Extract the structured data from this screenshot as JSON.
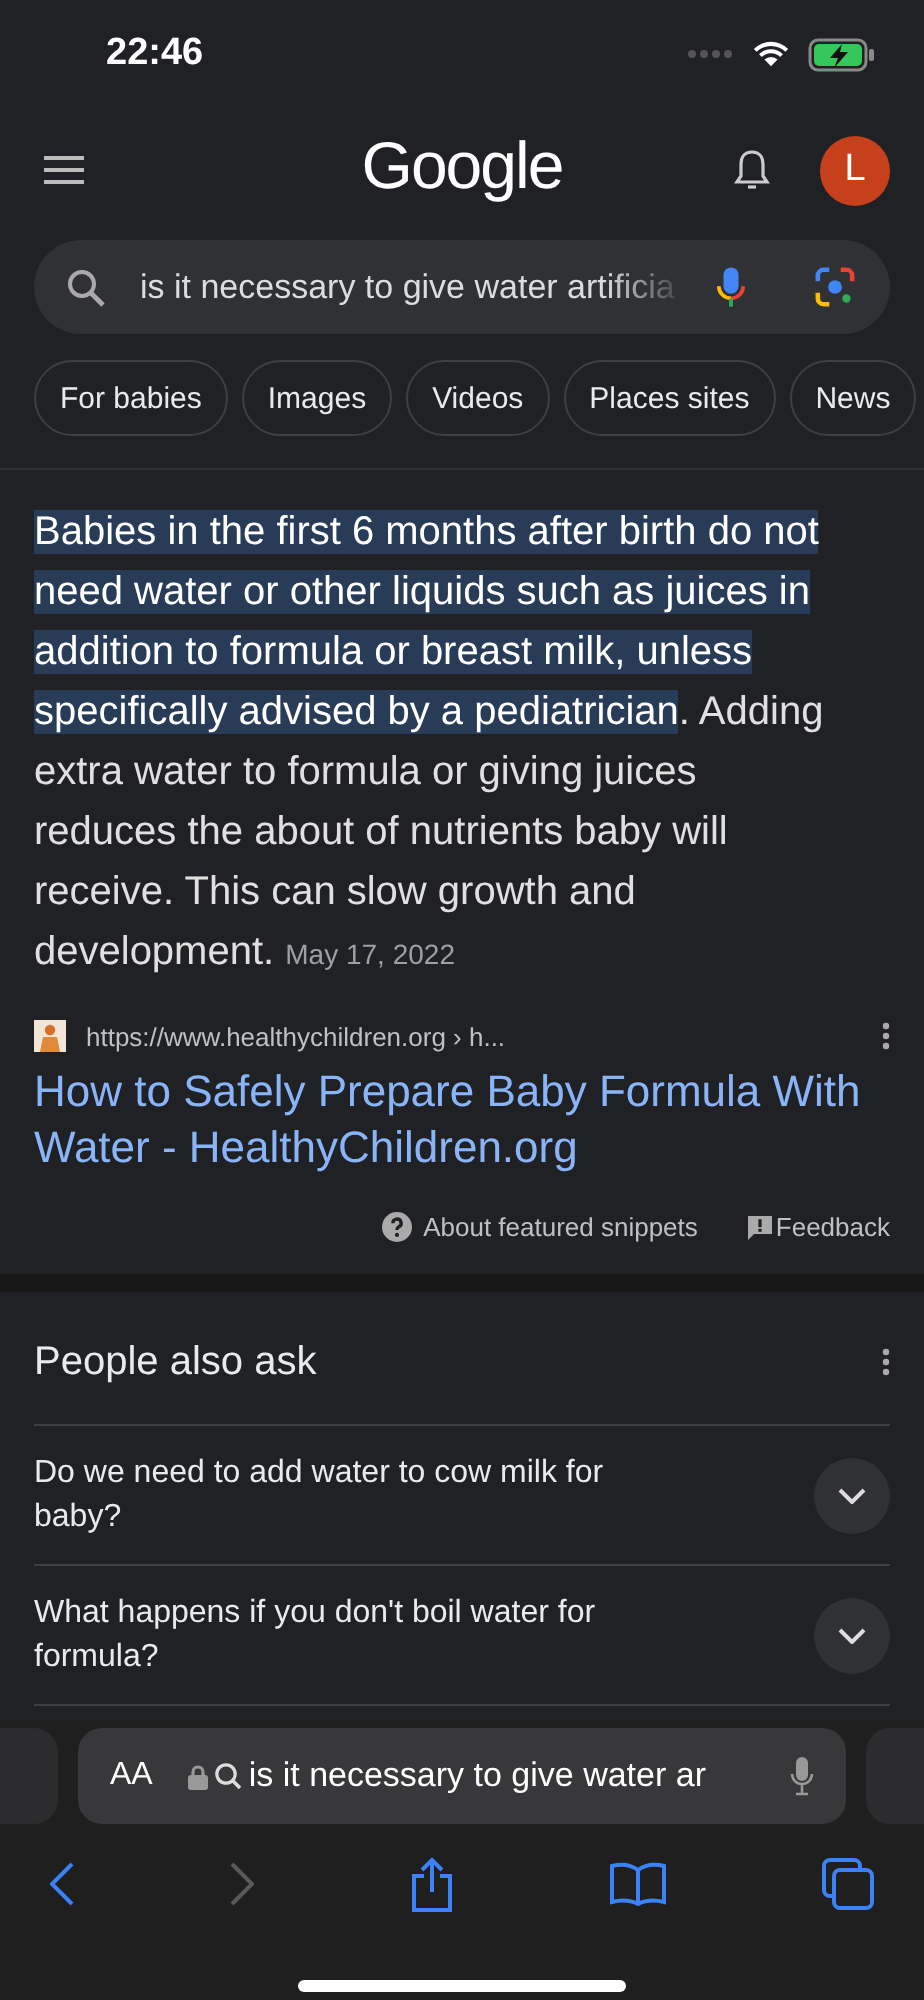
{
  "status_bar": {
    "time": "22:46"
  },
  "header": {
    "logo": "Google",
    "avatar": "L"
  },
  "search": {
    "value": "is it necessary to give water artificia"
  },
  "chips": [
    {
      "label": "For babies"
    },
    {
      "label": "Images"
    },
    {
      "label": "Videos"
    },
    {
      "label": "Places sites"
    },
    {
      "label": "News"
    }
  ],
  "snippet": {
    "highlighted": "Babies in the first 6 months after birth do not need water or other liquids such as juices in addition to formula or breast milk, unless specifically advised by a pediatrician",
    "rest": ". Adding extra water to formula or giving juices reduces the about of nutrients baby will receive. This can slow growth and development.",
    "date": "May 17, 2022"
  },
  "source": {
    "url": "https://www.healthychildren.org › h...",
    "title": "How to Safely Prepare Baby Formula With Water - HealthyChildren.org"
  },
  "snippet_footer": {
    "about": "About featured snippets",
    "feedback": "Feedback"
  },
  "people_also_ask": {
    "title": "People also ask",
    "questions": [
      {
        "text": "Do we need to add water to cow milk for baby?",
        "expanded": false
      },
      {
        "text": "What happens if you don't boil water for formula?",
        "expanded": false
      }
    ]
  },
  "browser_bar": {
    "text_size": "AA",
    "address": "is it necessary to give water ar"
  }
}
